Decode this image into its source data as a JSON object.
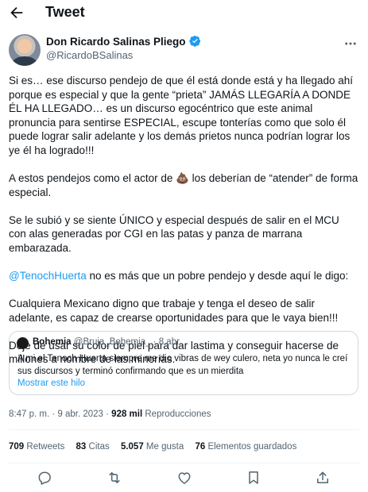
{
  "header": {
    "title": "Tweet",
    "back_icon": "arrow-left-icon"
  },
  "author": {
    "name": "Don Ricardo Salinas Pliego",
    "handle": "@RicardoBSalinas",
    "verified": true,
    "more_icon": "more-horizontal-icon"
  },
  "tweet": {
    "paragraphs": [
      "Si es… ese discurso pendejo de que él está donde está y ha llegado ahí porque es especial y que la gente “prieta” JAMÁS LLEGARÍA A DONDE ÉL HA LLEGADO… es un discurso egocéntrico que este animal pronuncia para sentirse ESPECIAL, escupe tonterías como que solo él puede lograr salir adelante y los demás prietos nunca podrían lograr los ye él ha logrado!!!",
      "A estos pendejos como el actor de 💩 los deberían de “atender” de forma especial.",
      "Se le subió y se siente ÚNICO y especial después de salir en el MCU con alas generadas por CGI en las patas y panza de marrana embarazada.",
      "Cualquiera Mexicano digno que trabaje y tenga el deseo de salir adelante, es capaz de crearse oportunidades para que le vaya bien!!!",
      "Deje de usar su color de piel para dar lastima y conseguir hacerse de millones a nombre de las minorías."
    ],
    "mention": "@TenochHuerta",
    "mention_rest": " no es más que un pobre pendejo y desde aquí le digo:"
  },
  "quote": {
    "name": "Bohemia",
    "handle": "@Bruja_Bohemia_",
    "separator": " · ",
    "date": "8 abr.",
    "text": "A mi el Tenoch Huerta siempre me dio vibras de wey culero, neta yo nunca le creí sus discursos y terminó confirmando que es un mierdita",
    "show_thread": "Mostrar este hilo"
  },
  "meta": {
    "time": "8:47 p. m.",
    "date": "9 abr. 2023",
    "views": "928 mil",
    "views_label": "Reproducciones",
    "sep": " · "
  },
  "stats": {
    "retweets": "709",
    "retweets_label": "Retweets",
    "quotes": "83",
    "quotes_label": "Citas",
    "likes": "5.057",
    "likes_label": "Me gusta",
    "bookmarks": "76",
    "bookmarks_label": "Elementos guardados"
  },
  "actions": [
    "reply-icon",
    "retweet-icon",
    "like-icon",
    "bookmark-icon",
    "share-icon"
  ],
  "colors": {
    "accent": "#1d9bf0",
    "text": "#0f1419",
    "muted": "#536471",
    "border": "#cfd9de"
  }
}
